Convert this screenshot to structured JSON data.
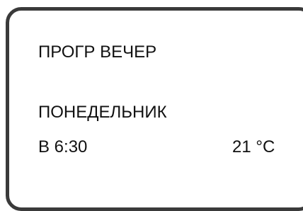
{
  "display": {
    "program_title": "ПРОГР ВЕЧЕР",
    "day": "ПОНЕДЕЛЬНИК",
    "time": "В 6:30",
    "temperature": "21 °C"
  },
  "colors": {
    "frame": "#3a3a3a",
    "text": "#111111",
    "background": "#ffffff"
  }
}
